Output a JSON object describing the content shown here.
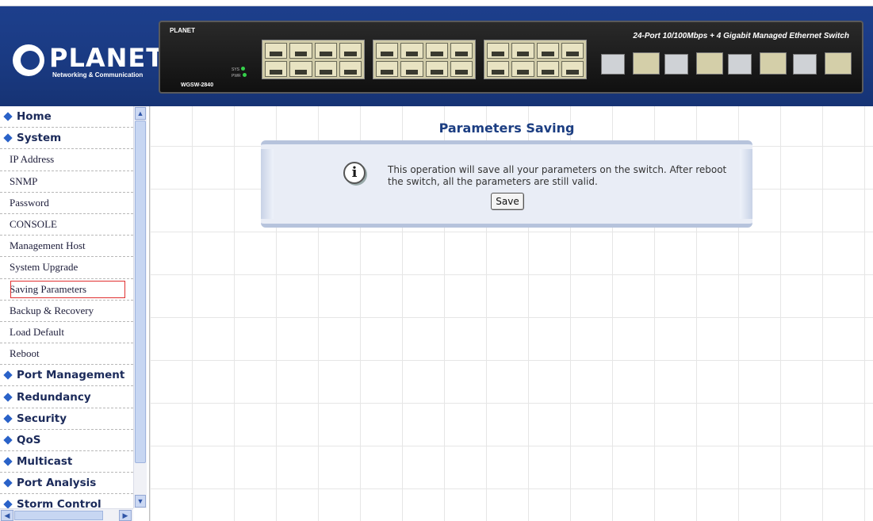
{
  "brand": {
    "name": "PLANET",
    "tagline": "Networking & Communication"
  },
  "device": {
    "brand_small": "PLANET",
    "model": "WGSW-2840",
    "title": "24-Port 10/100Mbps + 4 Gigabit Managed Ethernet Switch",
    "led_labels": [
      "SYS",
      "PWR"
    ]
  },
  "sidebar": {
    "items": [
      {
        "label": "Home",
        "type": "section"
      },
      {
        "label": "System",
        "type": "section"
      },
      {
        "label": "IP Address",
        "type": "sub"
      },
      {
        "label": "SNMP",
        "type": "sub"
      },
      {
        "label": "Password",
        "type": "sub"
      },
      {
        "label": "CONSOLE",
        "type": "sub"
      },
      {
        "label": "Management Host",
        "type": "sub"
      },
      {
        "label": "System Upgrade",
        "type": "sub"
      },
      {
        "label": "Saving Parameters",
        "type": "sub",
        "selected": true
      },
      {
        "label": "Backup & Recovery",
        "type": "sub"
      },
      {
        "label": "Load Default",
        "type": "sub"
      },
      {
        "label": "Reboot",
        "type": "sub"
      },
      {
        "label": "Port Management",
        "type": "section"
      },
      {
        "label": "Redundancy",
        "type": "section"
      },
      {
        "label": "Security",
        "type": "section"
      },
      {
        "label": "QoS",
        "type": "section"
      },
      {
        "label": "Multicast",
        "type": "section"
      },
      {
        "label": "Port Analysis",
        "type": "section"
      },
      {
        "label": "Storm Control",
        "type": "section"
      }
    ]
  },
  "main": {
    "title": "Parameters Saving",
    "message": "This operation will save all your parameters on the switch. After reboot the switch, all the parameters are still valid.",
    "save_label": "Save"
  },
  "colors": {
    "header_bg": "#1b3c86",
    "title": "#1c3e82",
    "selected_outline": "#e03030",
    "bullet": "#2a62c8"
  }
}
